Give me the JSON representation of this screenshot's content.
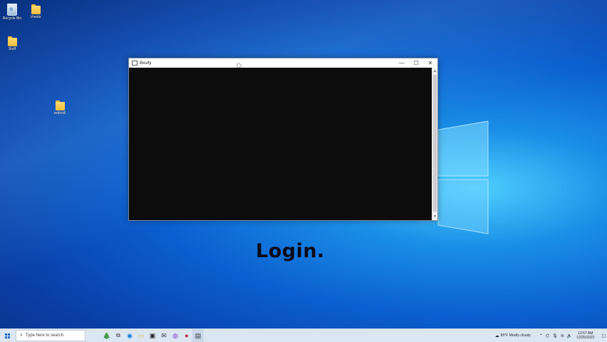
{
  "desktop": {
    "icons": [
      {
        "name": "recycle-bin",
        "label": "Recycle Bin"
      },
      {
        "name": "folder-cheats",
        "label": "cheats"
      },
      {
        "name": "folder-stuff",
        "label": "Stuff"
      },
      {
        "name": "folder-webcoll",
        "label": "webcoll"
      }
    ]
  },
  "window": {
    "title": "Bxuify",
    "minimize": "—",
    "maximize": "☐",
    "close": "✕"
  },
  "caption": "Login.",
  "taskbar": {
    "search_placeholder": "Type here to search",
    "weather": "65°F  Mostly cloudy",
    "time": "12:57 AM",
    "date": "12/25/2023"
  }
}
